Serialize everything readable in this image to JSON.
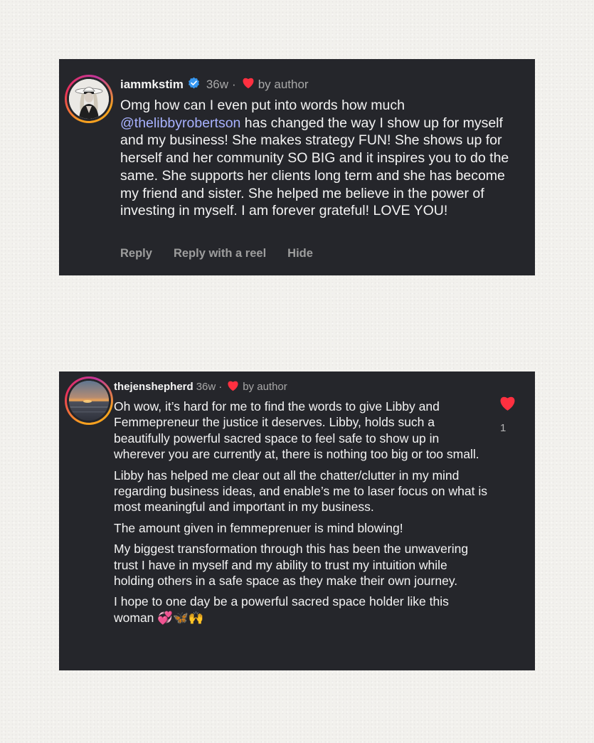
{
  "comments": [
    {
      "username": "iammkstim",
      "time": "36w",
      "separator": "·",
      "liked_by": "by author",
      "mention": "@thelibbyrobertson",
      "text_before_mention": "Omg how can I even put into words how much ",
      "text_after_mention": " has changed the way I show up for myself and my business! She makes strategy FUN!  She shows up for herself and her community SO BIG and it inspires you to do the same.  She supports her clients long term and she has become my friend and sister. She helped me believe in the power of investing in myself.  I am forever grateful! LOVE YOU!",
      "actions": {
        "reply": "Reply",
        "reply_reel": "Reply with a reel",
        "hide": "Hide"
      }
    },
    {
      "username": "thejenshepherd",
      "time": "36w",
      "separator": "·",
      "liked_by": "by author",
      "paragraphs": [
        "Oh wow, it’s hard for me to find the words to give Libby and Femmepreneur the justice it deserves. Libby, holds such a beautifully powerful sacred space to feel safe to show up in wherever you are currently at, there is nothing too big or too small.",
        "Libby has helped me clear out all the chatter/clutter in my mind regarding business ideas, and enable’s me to laser focus on what is most meaningful and important in my business.",
        "The amount given in femmeprenuer is mind blowing!",
        "My biggest transformation through this has been the unwavering trust I have in myself and my ability to trust my intuition while holding others in a safe space as they make their own journey.",
        "I hope to one day be a powerful sacred space holder like this woman"
      ],
      "emojis": [
        "💞",
        "🦋",
        "🙌"
      ],
      "like_count": "1"
    }
  ],
  "colors": {
    "card": "#25262b",
    "mention": "#a8b2ff",
    "heart": "#ff3040",
    "verified": "#3797f0",
    "muted": "#a8a8a8"
  }
}
